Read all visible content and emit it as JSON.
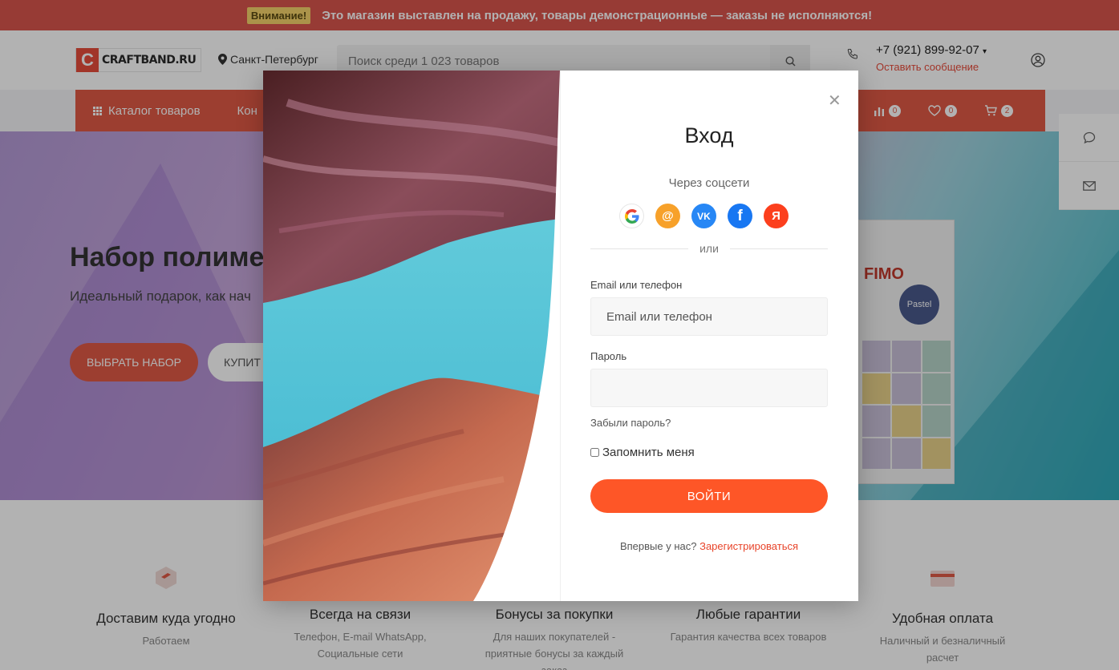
{
  "notice": {
    "badge": "Внимание!",
    "message": "Это магазин выставлен на продажу, товары демонстрационные — заказы не исполняются!"
  },
  "header": {
    "logo_letter": "C",
    "logo_text": "CRAFTBAND.RU",
    "city": "Санкт-Петербург",
    "search_placeholder": "Поиск среди 1 023 товаров",
    "phone": "+7 (921) 899-92-07",
    "phone_action": "Оставить сообщение"
  },
  "navbar": {
    "catalog": "Каталог товаров",
    "next_item": "Кон",
    "counters": {
      "compare": "0",
      "favorites": "0",
      "cart": "2"
    }
  },
  "hero": {
    "title": "Набор полимер",
    "subtitle": "Идеальный подарок, как нач",
    "primary_button": "ВЫБРАТЬ НАБОР",
    "secondary_button": "КУПИТ",
    "product_brand": "FIMO",
    "product_line": "Pastel"
  },
  "features": [
    {
      "title": "Доставим куда угодно",
      "desc": "Работаем"
    },
    {
      "title": "Всегда на связи",
      "desc": "Телефон, E-mail WhatsApp, Социальные сети"
    },
    {
      "title": "Бонусы за покупки",
      "desc": "Для наших покупателей - приятные бонусы за каждый заказ"
    },
    {
      "title": "Любые гарантии",
      "desc": "Гарантия качества всех товаров"
    },
    {
      "title": "Удобная оплата",
      "desc": "Наличный и безналичный расчет"
    }
  ],
  "modal": {
    "title": "Вход",
    "social_label": "Через соцсети",
    "socials": {
      "google": "G",
      "mail": "@",
      "vk": "VK",
      "facebook": "f",
      "yandex": "Я"
    },
    "or": "или",
    "login_label": "Email или телефон",
    "login_placeholder": "Email или телефон",
    "password_label": "Пароль",
    "forgot": "Забыли пароль?",
    "remember": "Запомнить меня",
    "submit": "ВОЙТИ",
    "register_prompt": "Впервые у нас?",
    "register_link": "Зарегистрироваться"
  },
  "colors": {
    "brand": "#e05a46",
    "accent": "#fe5627",
    "link": "#e8442a"
  },
  "icons": [
    "map-pin-icon",
    "search-icon",
    "phone-icon",
    "user-icon",
    "grid-icon",
    "compare-icon",
    "heart-icon",
    "cart-icon",
    "chat-icon",
    "mail-icon",
    "close-icon"
  ]
}
